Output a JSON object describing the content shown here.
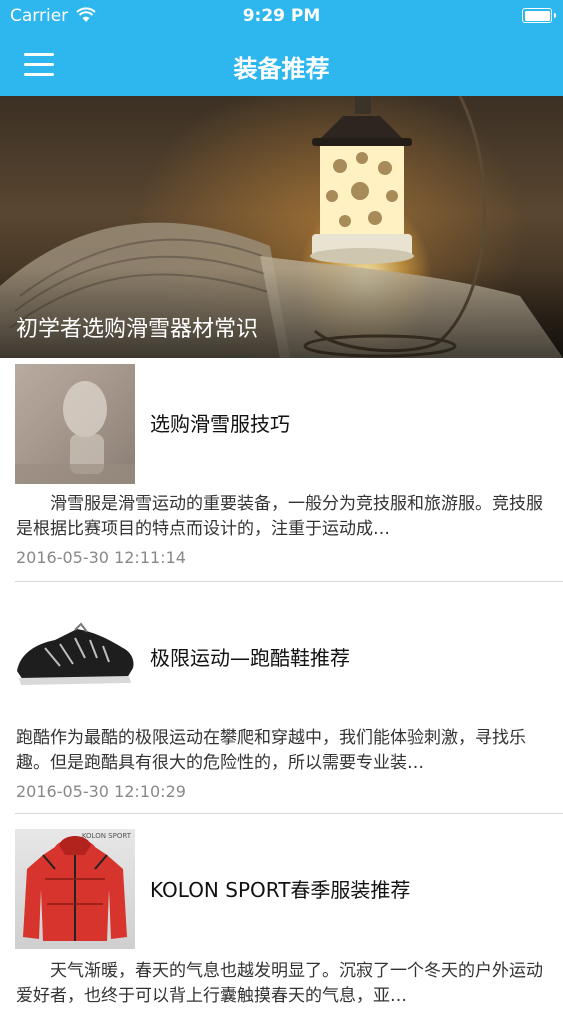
{
  "status_bar": {
    "carrier": "Carrier",
    "time": "9:29 PM"
  },
  "nav": {
    "title": "装备推荐"
  },
  "hero": {
    "caption": "初学者选购滑雪器材常识"
  },
  "articles": [
    {
      "title": "选购滑雪服技巧",
      "summary": "　　滑雪服是滑雪运动的重要装备，一般分为竞技服和旅游服。竞技服是根据比赛项目的特点而设计的，注重于运动成…",
      "date": "2016-05-30 12:11:14"
    },
    {
      "title": "极限运动—跑酷鞋推荐",
      "summary": "跑酷作为最酷的极限运动在攀爬和穿越中，我们能体验刺激，寻找乐趣。但是跑酷具有很大的危险性的，所以需要专业装…",
      "date": "2016-05-30 12:10:29"
    },
    {
      "title": "KOLON SPORT春季服装推荐",
      "summary": "　　天气渐暖，春天的气息也越发明显了。沉寂了一个冬天的户外运动爱好者，也终于可以背上行囊触摸春天的气息，亚…",
      "thumb_brand": "KOLON SPORT"
    }
  ],
  "colors": {
    "accent": "#2eb6ee"
  },
  "icons": {
    "menu": "hamburger-menu-icon",
    "wifi": "wifi-icon",
    "battery": "battery-icon"
  }
}
